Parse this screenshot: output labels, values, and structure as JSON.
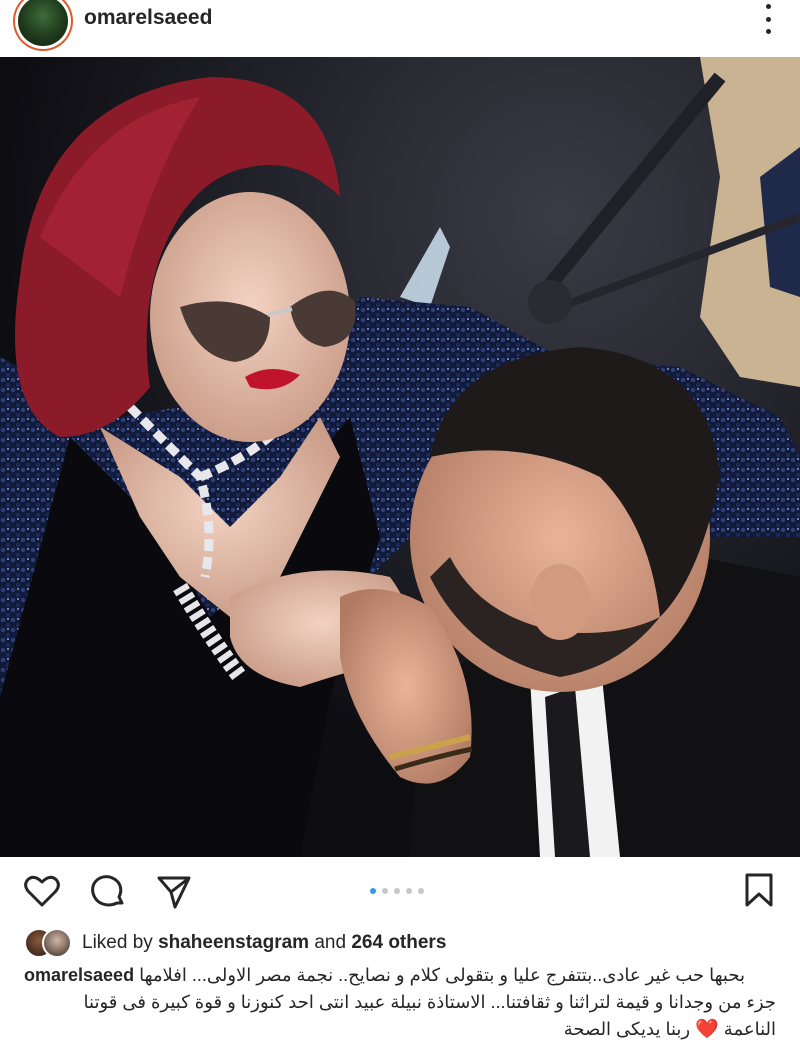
{
  "post": {
    "username": "omarelsaeed"
  },
  "likes": {
    "prefix": "Liked by",
    "user": "shaheenstagram",
    "connector": "and",
    "others": "264 others"
  },
  "caption": {
    "username": "omarelsaeed",
    "line1": "بحبها حب غير عادى..بتتفرج عليا و بتقولى كلام و نصايح.. نجمة مصر الاولى... افلامها",
    "line2": "جزء من وجدانا و قيمة لتراثنا و ثقافتنا... الاستاذة نبيلة عبيد انتى احد كنوزنا و قوة كبيرة فى قوتنا",
    "line3_start": "الناعمة",
    "heart": "❤️",
    "line3_end": "ربنا يديكى الصحة"
  },
  "carousel": {
    "count": 5,
    "active": 1
  },
  "colors": {
    "accent_blue": "#3797f0",
    "story_ring": "#dd5a2a",
    "text": "#262626"
  },
  "icons": [
    "more-icon",
    "heart-icon",
    "comment-icon",
    "share-icon",
    "bookmark-icon"
  ]
}
